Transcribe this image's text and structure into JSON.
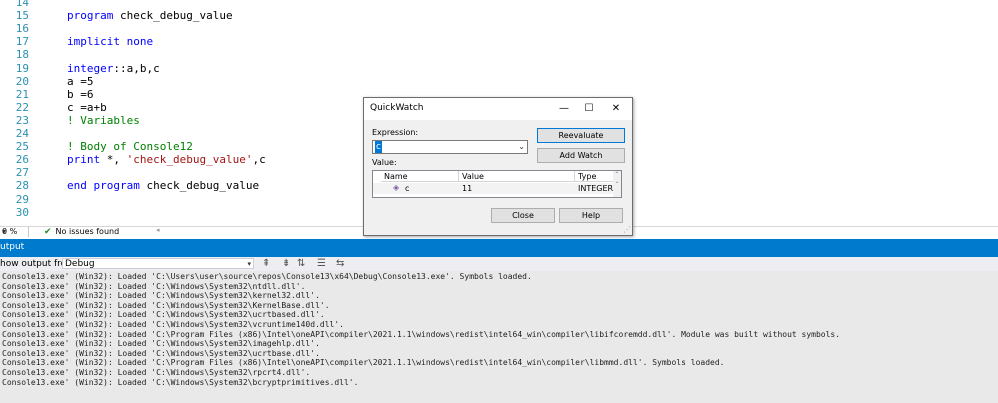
{
  "editor": {
    "lines": [
      {
        "num": "14",
        "text": "",
        "class": ""
      },
      {
        "num": "15",
        "text": "program check_debug_value",
        "class": "kw"
      },
      {
        "num": "16",
        "text": "",
        "class": ""
      },
      {
        "num": "17",
        "text": "implicit none",
        "class": "kw"
      },
      {
        "num": "18",
        "text": "",
        "class": ""
      },
      {
        "num": "19",
        "text": "integer::a,b,c",
        "class": "kw"
      },
      {
        "num": "20",
        "text": "a =5",
        "class": ""
      },
      {
        "num": "21",
        "text": "b =6",
        "class": ""
      },
      {
        "num": "22",
        "text": "c =a+b",
        "class": ""
      },
      {
        "num": "23",
        "text": "! Variables",
        "class": "cm"
      },
      {
        "num": "24",
        "text": "",
        "class": ""
      },
      {
        "num": "25",
        "text": "! Body of Console12",
        "class": "cm"
      },
      {
        "num": "26",
        "text": "print *, 'check_debug_value',c",
        "class": "mixed"
      },
      {
        "num": "27",
        "text": "",
        "class": ""
      },
      {
        "num": "28",
        "text": "end program check_debug_value",
        "class": "kw"
      },
      {
        "num": "29",
        "text": "",
        "class": ""
      },
      {
        "num": "30",
        "text": "",
        "class": ""
      }
    ],
    "print_parts": {
      "kw": "print",
      "mid": " *, ",
      "str": "'check_debug_value'",
      "end": ",c"
    },
    "end_parts": {
      "kw": "end program",
      "rest": " check_debug_value"
    },
    "integer_parts": {
      "kw": "integer",
      "rest": "::a,b,c"
    },
    "program_parts": {
      "kw": "program",
      "rest": " check_debug_value"
    }
  },
  "status": {
    "zoom": "0 %",
    "issues": "No issues found"
  },
  "output": {
    "title": "utput",
    "show_label": "how output from:",
    "source": "Debug",
    "lines": [
      "Console13.exe' (Win32): Loaded 'C:\\Users\\user\\source\\repos\\Console13\\x64\\Debug\\Console13.exe'. Symbols loaded.",
      "Console13.exe' (Win32): Loaded 'C:\\Windows\\System32\\ntdll.dll'.",
      "Console13.exe' (Win32): Loaded 'C:\\Windows\\System32\\kernel32.dll'.",
      "Console13.exe' (Win32): Loaded 'C:\\Windows\\System32\\KernelBase.dll'.",
      "Console13.exe' (Win32): Loaded 'C:\\Windows\\System32\\ucrtbased.dll'.",
      "Console13.exe' (Win32): Loaded 'C:\\Windows\\System32\\vcruntime140d.dll'.",
      "Console13.exe' (Win32): Loaded 'C:\\Program Files (x86)\\Intel\\oneAPI\\compiler\\2021.1.1\\windows\\redist\\intel64_win\\compiler\\libifcoremdd.dll'. Module was built without symbols.",
      "Console13.exe' (Win32): Loaded 'C:\\Windows\\System32\\imagehlp.dll'.",
      "Console13.exe' (Win32): Loaded 'C:\\Windows\\System32\\ucrtbase.dll'.",
      "Console13.exe' (Win32): Loaded 'C:\\Program Files (x86)\\Intel\\oneAPI\\compiler\\2021.1.1\\windows\\redist\\intel64_win\\compiler\\libmmd.dll'. Symbols loaded.",
      "Console13.exe' (Win32): Loaded 'C:\\Windows\\System32\\rpcrt4.dll'.",
      "Console13.exe' (Win32): Loaded 'C:\\Windows\\System32\\bcryptprimitives.dll'."
    ]
  },
  "quickwatch": {
    "title": "QuickWatch",
    "expression_label": "Expression:",
    "expression_value": "c",
    "value_label": "Value:",
    "reevaluate": "Reevaluate",
    "add_watch": "Add Watch",
    "close": "Close",
    "help": "Help",
    "columns": {
      "name": "Name",
      "value": "Value",
      "type": "Type"
    },
    "row": {
      "name": "c",
      "value": "11",
      "type": "INTEGER..."
    }
  }
}
